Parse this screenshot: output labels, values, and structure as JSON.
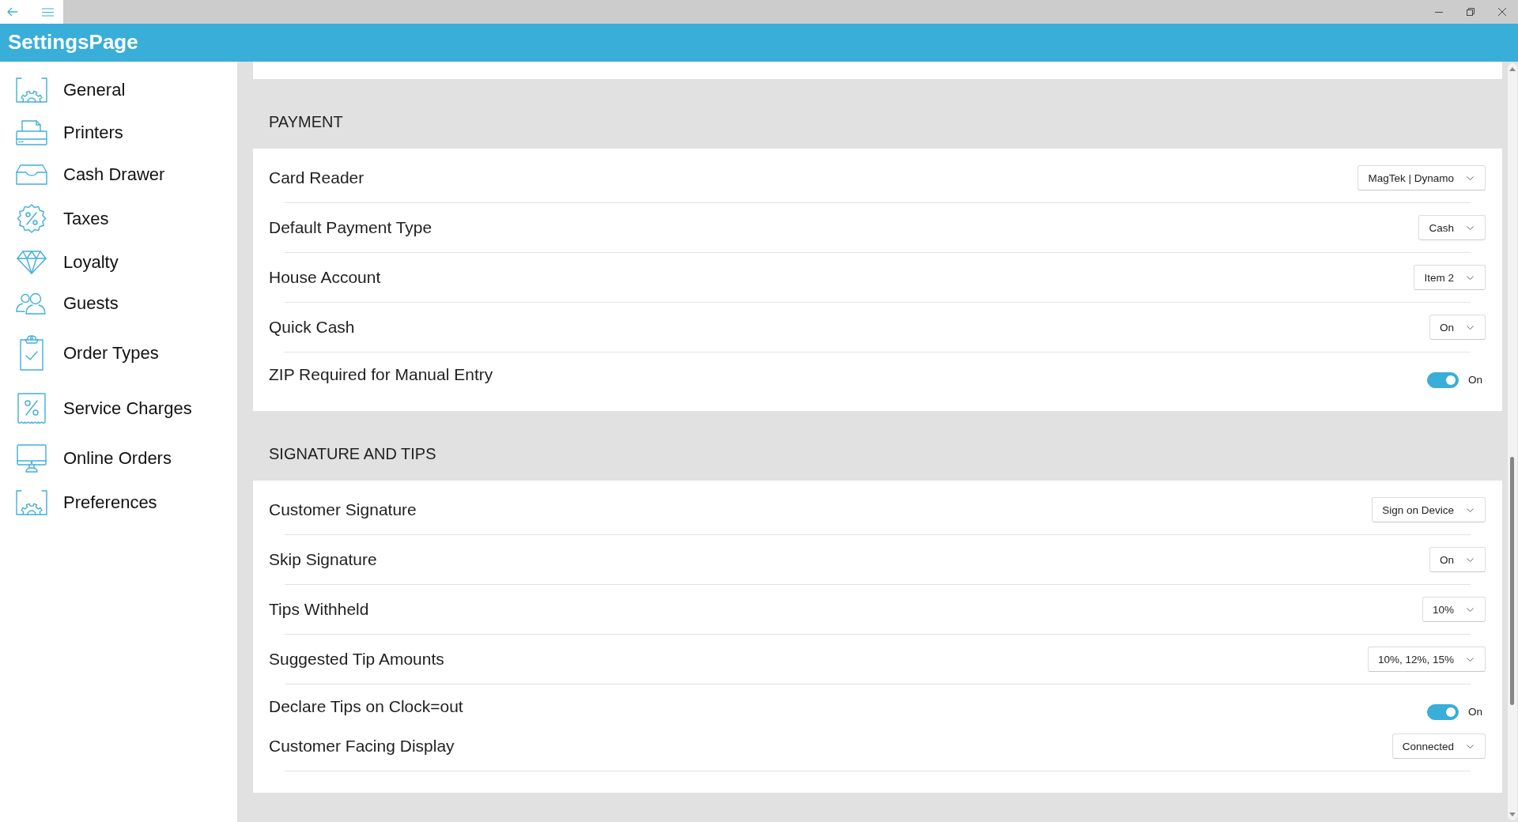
{
  "header": {
    "title": "SettingsPage"
  },
  "sidebar": {
    "items": [
      {
        "label": "General",
        "selected": false
      },
      {
        "label": "Printers",
        "selected": false
      },
      {
        "label": "Cash Drawer",
        "selected": false
      },
      {
        "label": "Taxes",
        "selected": false
      },
      {
        "label": "Loyalty",
        "selected": false
      },
      {
        "label": "Guests",
        "selected": false
      },
      {
        "label": "Order Types",
        "selected": false
      },
      {
        "label": "Service Charges",
        "selected": false
      },
      {
        "label": "Online Orders",
        "selected": false
      },
      {
        "label": "Preferences",
        "selected": false
      }
    ]
  },
  "sections": [
    {
      "title": "PAYMENT",
      "rows": [
        {
          "kind": "dropdown",
          "label": "Card Reader",
          "value": "MagTek | Dynamo"
        },
        {
          "kind": "dropdown",
          "label": "Default Payment Type",
          "value": "Cash"
        },
        {
          "kind": "dropdown",
          "label": "House Account",
          "value": "Item 2"
        },
        {
          "kind": "dropdown",
          "label": "Quick Cash",
          "value": "On"
        },
        {
          "kind": "toggle",
          "label": "ZIP Required for Manual Entry",
          "on": true,
          "state_label": "On"
        }
      ]
    },
    {
      "title": "SIGNATURE AND TIPS",
      "rows": [
        {
          "kind": "dropdown",
          "label": "Customer Signature",
          "value": "Sign on Device"
        },
        {
          "kind": "dropdown",
          "label": "Skip Signature",
          "value": "On"
        },
        {
          "kind": "dropdown",
          "label": "Tips Withheld",
          "value": "10%"
        },
        {
          "kind": "dropdown",
          "label": "Suggested Tip Amounts",
          "value": "10%, 12%, 15%"
        },
        {
          "kind": "toggle",
          "label": "Declare Tips on Clock=out",
          "on": true,
          "state_label": "On"
        },
        {
          "kind": "dropdown",
          "label": "Customer Facing Display",
          "value": "Connected"
        }
      ]
    }
  ]
}
